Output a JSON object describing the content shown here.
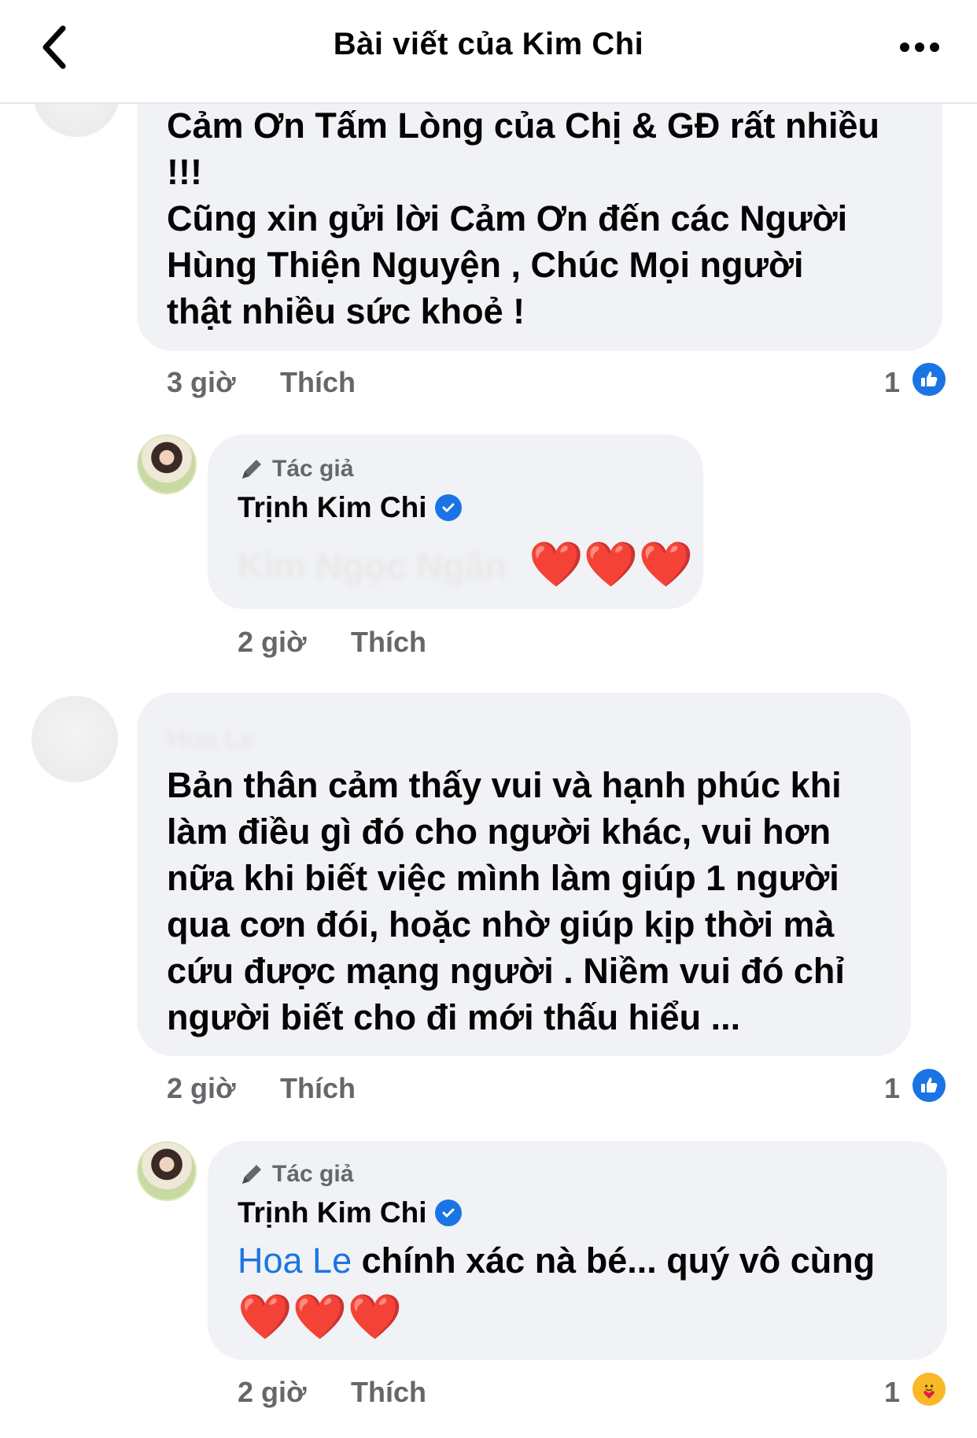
{
  "header": {
    "title": "Bài viết của Kim Chi",
    "back_icon": "chevron-left-icon",
    "more_icon": "more-horizontal-icon"
  },
  "comments": [
    {
      "text_lines": [
        "Cảm Ơn Tấm Lòng của Chị & GĐ rất nhiều",
        "!!!",
        "Cũng xin gửi lời Cảm Ơn đến các Người",
        "Hùng Thiện Nguyện , Chúc Mọi người",
        "thật nhiều sức khoẻ !"
      ],
      "time": "3 giờ",
      "like_label": "Thích",
      "reaction_count": "1",
      "reaction": "like"
    },
    {
      "author_name_blurred": "Hoa Le",
      "text_lines": [
        "Bản thân cảm thấy vui và hạnh phúc khi",
        "làm điều gì đó cho người khác, vui hơn",
        "nữa khi biết việc mình làm giúp 1 người",
        "qua cơn đói, hoặc nhờ giúp kịp thời mà",
        "cứu được mạng người . Niềm vui đó chỉ",
        "người biết cho đi mới thấu hiểu ..."
      ],
      "time": "2 giờ",
      "like_label": "Thích",
      "reaction_count": "1",
      "reaction": "like"
    }
  ],
  "replies": [
    {
      "author_tag": "Tác giả",
      "author_name": "Trịnh Kim Chi",
      "mention_blurred": "Kim Ngọc Ngân",
      "hearts": "❤️❤️❤️",
      "time": "2 giờ",
      "like_label": "Thích"
    },
    {
      "author_tag": "Tác giả",
      "author_name": "Trịnh Kim Chi",
      "mention": "Hoa Le",
      "text": " chính xác nà bé... quý vô cùng",
      "hearts": "❤️❤️❤️",
      "time": "2 giờ",
      "like_label": "Thích",
      "reaction_count": "1",
      "reaction": "care"
    }
  ],
  "colors": {
    "bubble": "#f0f2f5",
    "accent": "#1b74e4",
    "muted": "#65676b",
    "heart": "#e41e3f"
  }
}
